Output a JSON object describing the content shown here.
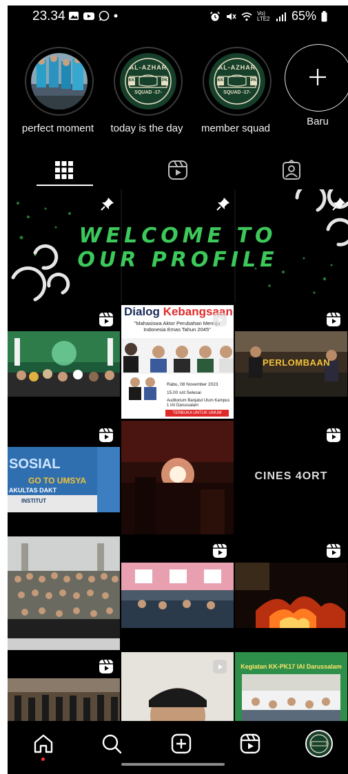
{
  "status_bar": {
    "time": "23.34",
    "network_label": "Vo) LTE2",
    "battery": "65%"
  },
  "highlights": [
    {
      "label": "perfect moment",
      "type": "photo"
    },
    {
      "label": "today is the day",
      "type": "logo",
      "logo_text": "AL-AZHAR",
      "logo_sub": "SQUAD -17-",
      "logo_left": "KK",
      "logo_right": "PK"
    },
    {
      "label": "member squad",
      "type": "logo",
      "logo_text": "AL-AZHAR",
      "logo_sub": "SQUAD -17-",
      "logo_left": "KK",
      "logo_right": "PK"
    },
    {
      "label": "Baru",
      "type": "new"
    }
  ],
  "tabs": [
    {
      "name": "grid",
      "icon": "grid-icon",
      "active": true
    },
    {
      "name": "reels",
      "icon": "reels-icon",
      "active": false
    },
    {
      "name": "tagged",
      "icon": "tagged-person-icon",
      "active": false
    }
  ],
  "pinned_post": {
    "line1": "WELCOME TO",
    "line2": "OUR PROFILE"
  },
  "posts": {
    "dialog_title_a": "Dialog",
    "dialog_title_b": "Kebangsaan",
    "dialog_subtitle": "\"Mahasiswa Aktor Perubahan Menuju Indonesia Emas Tahun 2045\"",
    "dialog_date": "Rabu, 08 November 2023",
    "dialog_time": "15.00 s/d Selesai",
    "dialog_place": "Auditorium Banjatul Ulum Kampus 1 IAI Darussalam",
    "dialog_banner": "TERBUKA UNTUK UMUM",
    "perlombaan": "PERLOMBAAN",
    "sosial_line1": "SOSIAL",
    "sosial_line2": "GO TO UMSYA",
    "sosial_line3": "AKULTAS DAKT",
    "sosial_line4": "INSTITUT",
    "cinelogo": "CINES 4ORT",
    "kegiatan": "Kegiatan KK-PK17 IAI Darussalam"
  },
  "colors": {
    "background": "#000000",
    "accent_green": "#3cc85a",
    "notification_red": "#ff3040"
  },
  "bottom_nav": [
    {
      "name": "home",
      "icon": "home-icon"
    },
    {
      "name": "search",
      "icon": "search-icon"
    },
    {
      "name": "create",
      "icon": "plus-square-icon"
    },
    {
      "name": "reels",
      "icon": "reels-icon"
    },
    {
      "name": "profile",
      "icon": "profile-avatar"
    }
  ]
}
